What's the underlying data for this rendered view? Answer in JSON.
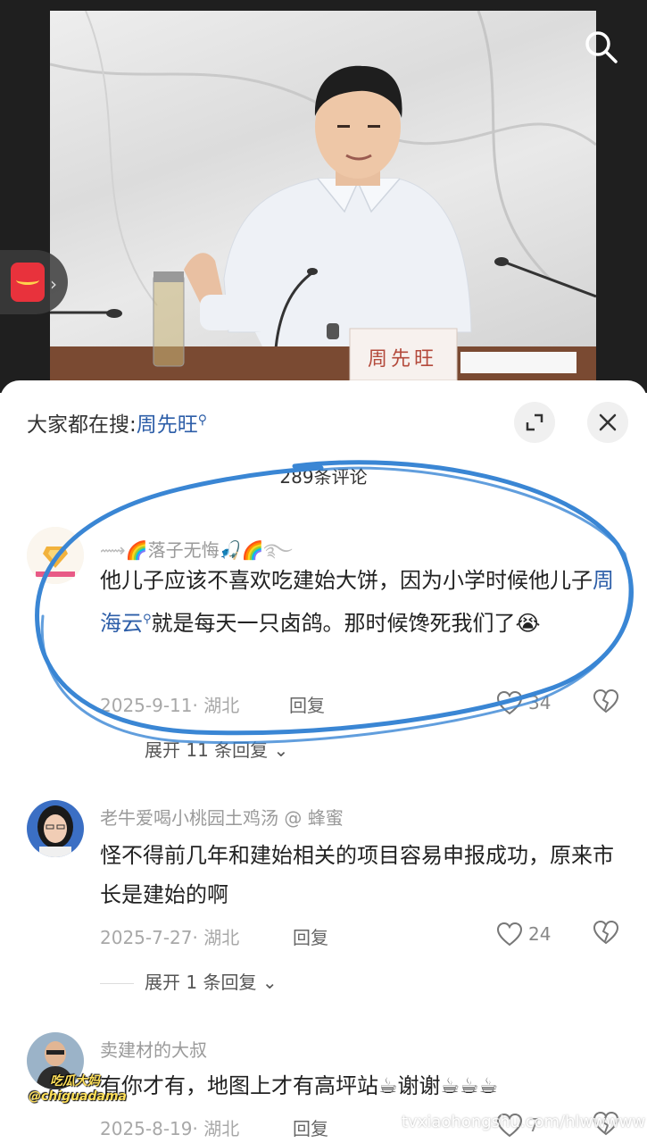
{
  "video": {
    "nameplate": "周先旺",
    "search_icon": "search-icon",
    "redpacket_icon": "red-packet-icon"
  },
  "sheet": {
    "search_hint_prefix": "大家都在搜:",
    "search_hint_keyword": "周先旺",
    "comment_count": "289条评论",
    "expand_icon": "expand-icon",
    "close_icon": "close-icon"
  },
  "comments": [
    {
      "username": "落子无悔",
      "text_part1": "他儿子应该不喜欢吃建始大饼，因为小学时候他儿子",
      "text_link": "周海云",
      "text_part2": "就是每天一只卤鸽。那时候馋死我们了",
      "date_loc": "2025-9-11· 湖北",
      "reply_label": "回复",
      "likes": "34",
      "expand_label": "展开 11 条回复"
    },
    {
      "username": "老牛爱喝小桃园土鸡汤 @ 蜂蜜",
      "text": "怪不得前几年和建始相关的项目容易申报成功，原来市长是建始的啊",
      "date_loc": "2025-7-27· 湖北",
      "reply_label": "回复",
      "likes": "24",
      "expand_label": "展开 1 条回复"
    },
    {
      "username": "卖建材的大叔",
      "text_part1": "有你才有，地图上才有高坪站",
      "text_part2": "谢谢",
      "date_loc": "2025-8-19· 湖北",
      "reply_label": "回复",
      "likes": "7"
    }
  ],
  "watermark": {
    "name": "吃瓜大妈",
    "handle": "@chiguadama",
    "url": "tvxiaohongshu.com/hlwwwww"
  },
  "colors": {
    "link": "#2d5ea8",
    "annotation": "#3a86d4"
  }
}
